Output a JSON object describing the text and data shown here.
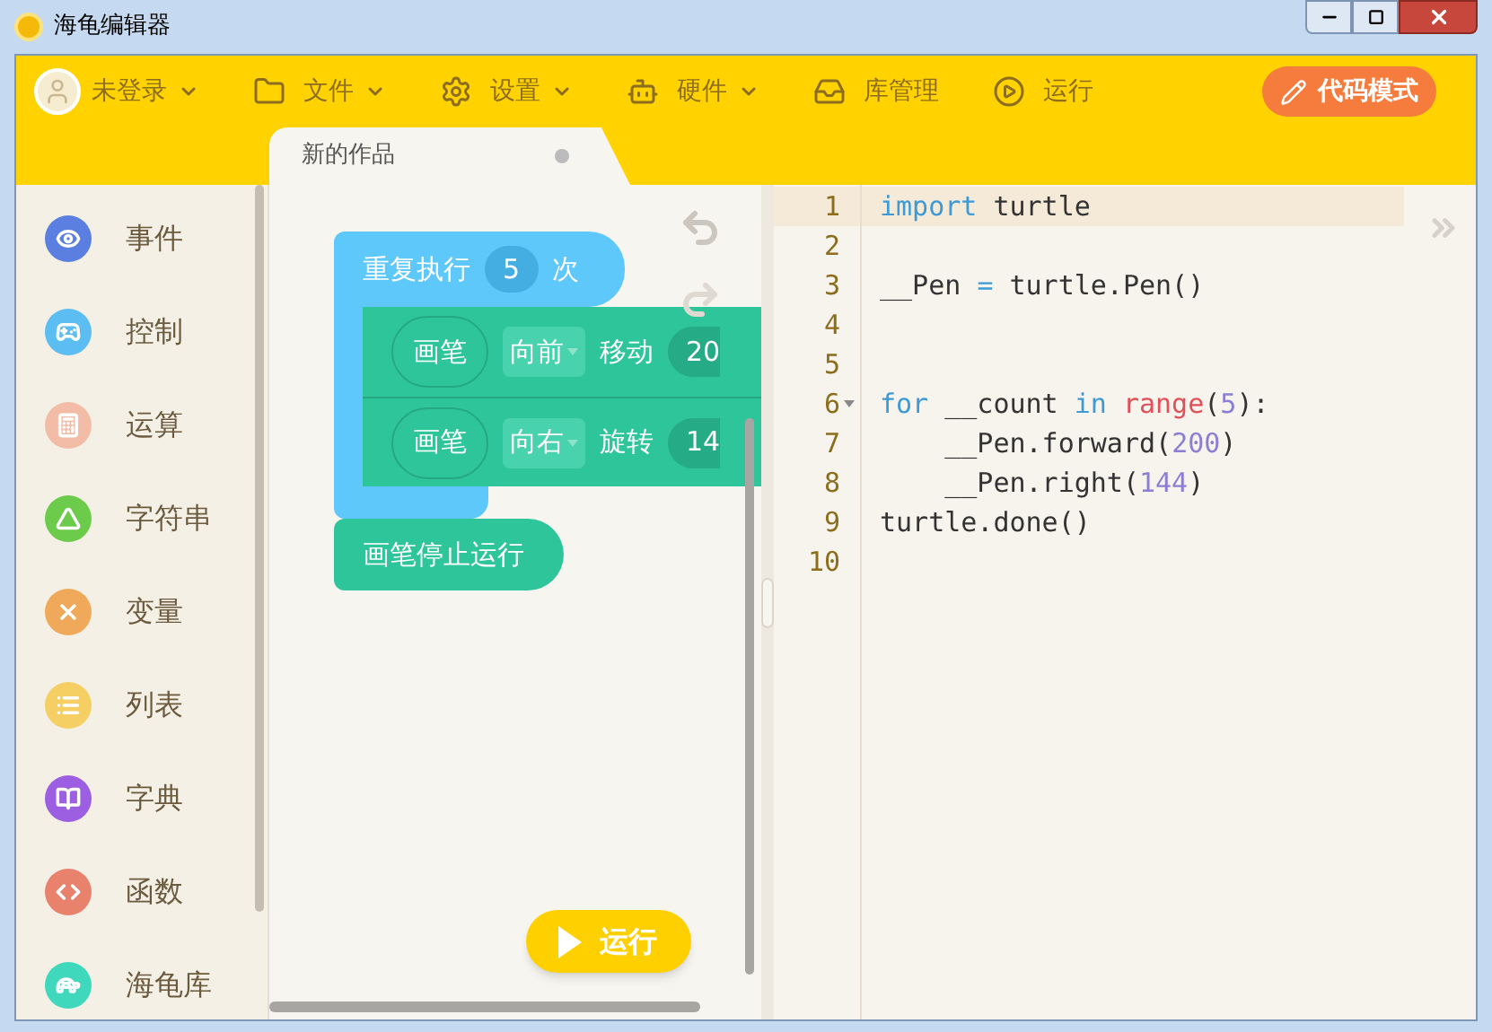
{
  "window": {
    "title": "海龟编辑器"
  },
  "toolbar": {
    "items": [
      {
        "kind": "user",
        "label": "未登录",
        "dropdown": true
      },
      {
        "kind": "file",
        "label": "文件",
        "dropdown": true
      },
      {
        "kind": "settings",
        "label": "设置",
        "dropdown": true
      },
      {
        "kind": "hardware",
        "label": "硬件",
        "dropdown": true
      },
      {
        "kind": "library",
        "label": "库管理",
        "dropdown": false
      },
      {
        "kind": "run",
        "label": "运行",
        "dropdown": false
      }
    ],
    "mode_button": "代码模式"
  },
  "tab": {
    "title": "新的作品"
  },
  "sidebar": {
    "items": [
      {
        "label": "事件",
        "color": "#5b7fe0",
        "kind": "event"
      },
      {
        "label": "控制",
        "color": "#5bbdf2",
        "kind": "control"
      },
      {
        "label": "运算",
        "color": "#f2bca6",
        "kind": "math"
      },
      {
        "label": "字符串",
        "color": "#6dcb4b",
        "kind": "string"
      },
      {
        "label": "变量",
        "color": "#f0a95a",
        "kind": "variable"
      },
      {
        "label": "列表",
        "color": "#f5cf63",
        "kind": "list"
      },
      {
        "label": "字典",
        "color": "#9c5fe2",
        "kind": "dict"
      },
      {
        "label": "函数",
        "color": "#e8826c",
        "kind": "function"
      },
      {
        "label": "海龟库",
        "color": "#40d8bd",
        "kind": "turtle"
      }
    ]
  },
  "blocks": {
    "repeat": {
      "label": "重复执行",
      "count": "5",
      "unit": "次"
    },
    "inner": [
      {
        "target": "画笔",
        "direction": "向前",
        "action": "移动",
        "value": "20"
      },
      {
        "target": "画笔",
        "direction": "向右",
        "action": "旋转",
        "value": "14"
      }
    ],
    "stop": "画笔停止运行"
  },
  "run_button": "运行",
  "editor": {
    "lines": [
      {
        "number": "1",
        "active": true,
        "foldable": false,
        "tokens": [
          {
            "kind": "keyword",
            "text": "import"
          },
          {
            "kind": "plain",
            "text": " turtle"
          }
        ]
      },
      {
        "number": "2",
        "active": false,
        "foldable": false
      },
      {
        "number": "3",
        "active": false,
        "foldable": false,
        "tokens": [
          {
            "kind": "plain",
            "text": "__Pen "
          },
          {
            "kind": "operator",
            "text": "="
          },
          {
            "kind": "plain",
            "text": " turtle.Pen()"
          }
        ]
      },
      {
        "number": "4",
        "active": false,
        "foldable": false
      },
      {
        "number": "5",
        "active": false,
        "foldable": false
      },
      {
        "number": "6",
        "active": false,
        "foldable": true,
        "tokens": [
          {
            "kind": "keyword",
            "text": "for"
          },
          {
            "kind": "plain",
            "text": " __count "
          },
          {
            "kind": "keyword",
            "text": "in "
          },
          {
            "kind": "builtin",
            "text": "range"
          },
          {
            "kind": "plain",
            "text": "("
          },
          {
            "kind": "number",
            "text": "5"
          },
          {
            "kind": "plain",
            "text": "):"
          }
        ]
      },
      {
        "number": "7",
        "active": false,
        "foldable": false,
        "tokens": [
          {
            "kind": "plain",
            "text": "    __Pen.forward("
          },
          {
            "kind": "number",
            "text": "200"
          },
          {
            "kind": "plain",
            "text": ")"
          }
        ]
      },
      {
        "number": "8",
        "active": false,
        "foldable": false,
        "tokens": [
          {
            "kind": "plain",
            "text": "    __Pen.right("
          },
          {
            "kind": "number",
            "text": "144"
          },
          {
            "kind": "plain",
            "text": ")"
          }
        ]
      },
      {
        "number": "9",
        "active": false,
        "foldable": false,
        "tokens": [
          {
            "kind": "plain",
            "text": "turtle.done()"
          }
        ]
      },
      {
        "number": "10",
        "active": false,
        "foldable": false
      }
    ]
  }
}
